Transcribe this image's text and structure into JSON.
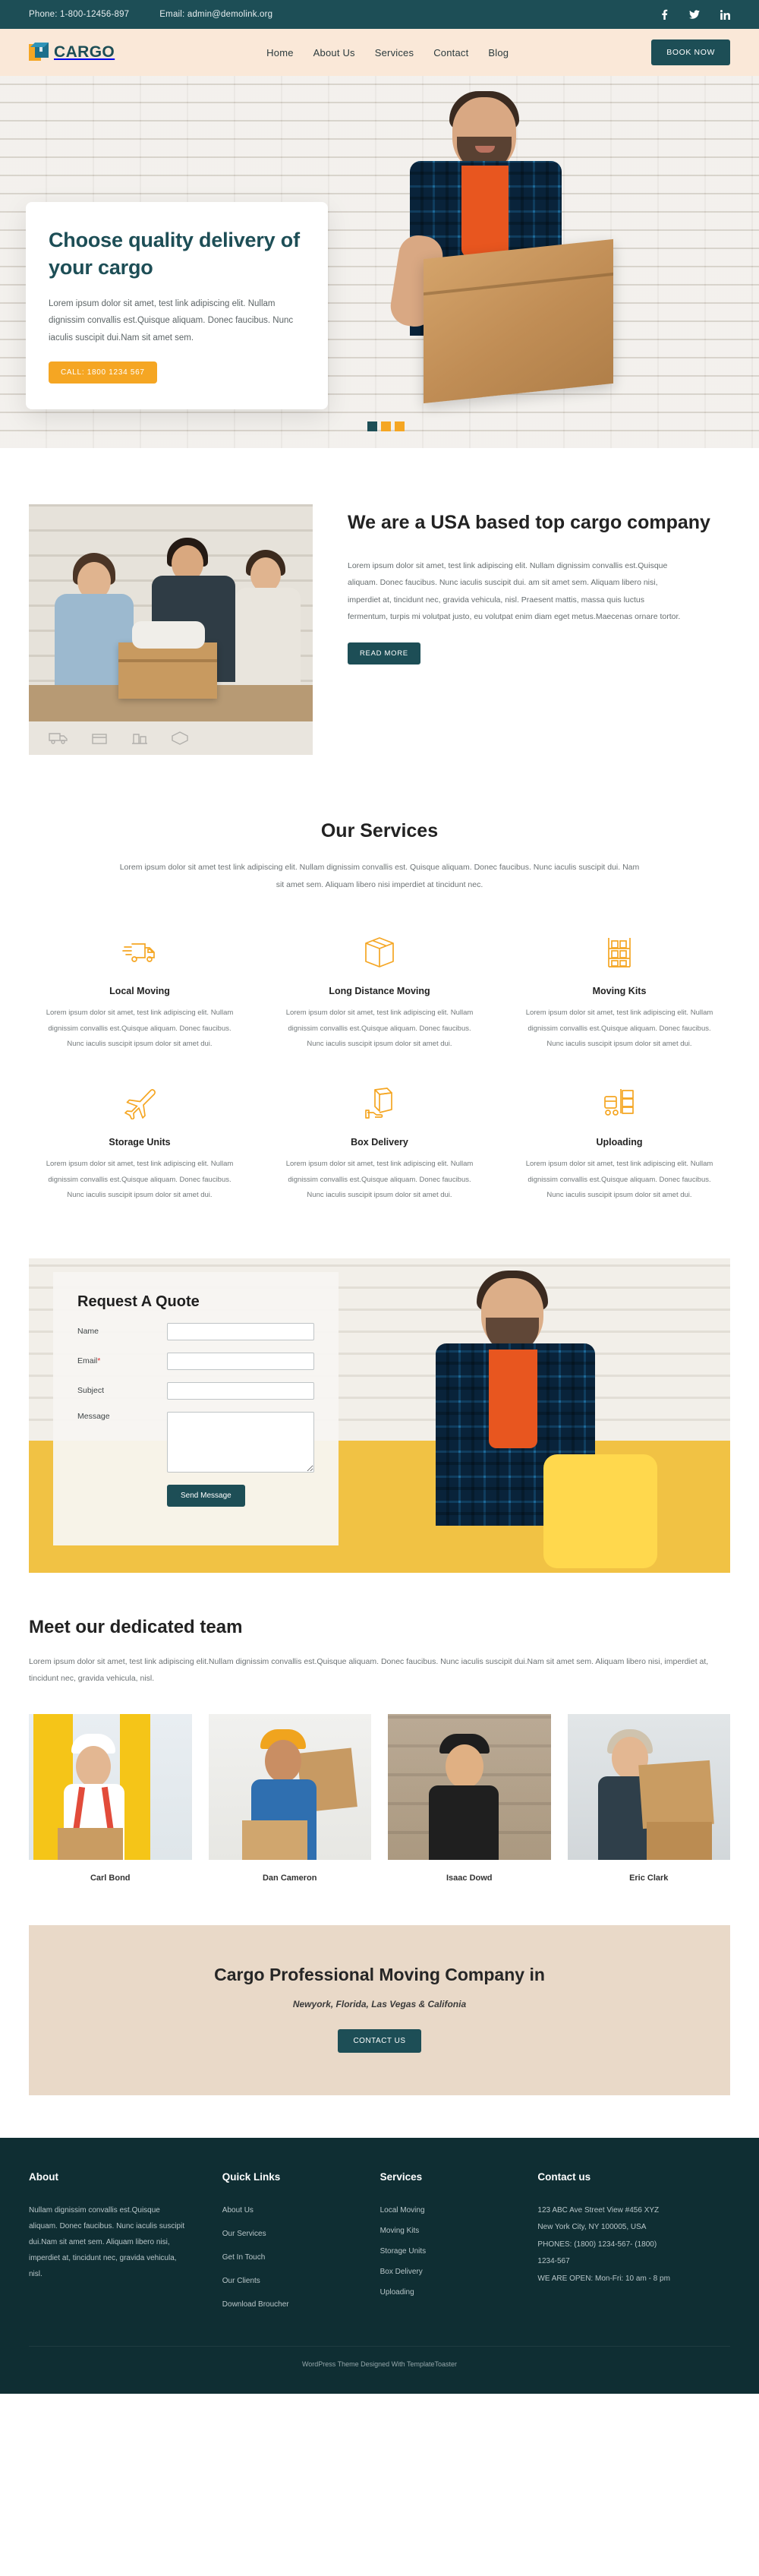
{
  "topbar": {
    "phone": "Phone: 1-800-12456-897",
    "email": "Email: admin@demolink.org",
    "social": [
      {
        "name": "facebook-icon",
        "label": "f"
      },
      {
        "name": "twitter-icon",
        "label": "t"
      },
      {
        "name": "linkedin-icon",
        "label": "in"
      }
    ]
  },
  "nav": {
    "brand": "CARGO",
    "links": [
      "Home",
      "About Us",
      "Services",
      "Contact",
      "Blog"
    ],
    "cta": "BOOK NOW"
  },
  "hero": {
    "title": "Choose quality delivery of your cargo",
    "body": "Lorem ipsum dolor sit amet, test link adipiscing elit. Nullam dignissim convallis est.Quisque aliquam. Donec faucibus. Nunc iaculis suscipit dui.Nam sit amet sem.",
    "button": "CALL: 1800 1234 567",
    "slides": 3,
    "active_slide": 1
  },
  "about": {
    "title": "We are a USA based top cargo company",
    "body": "Lorem ipsum dolor sit amet, test link adipiscing elit. Nullam dignissim convallis est.Quisque aliquam. Donec faucibus. Nunc iaculis suscipit dui. am sit amet sem. Aliquam libero nisi, imperdiet at, tincidunt nec, gravida vehicula, nisl. Praesent mattis, massa quis luctus fermentum, turpis mi volutpat justo, eu volutpat enim diam eget metus.Maecenas ornare tortor.",
    "button": "READ MORE"
  },
  "services": {
    "title": "Our Services",
    "subtitle": "Lorem ipsum dolor sit amet test link adipiscing elit. Nullam dignissim convallis est. Quisque aliquam. Donec faucibus. Nunc iaculis suscipit dui. Nam sit amet sem. Aliquam libero nisi imperdiet at tincidunt nec.",
    "body_text": "Lorem ipsum dolor sit amet, test link adipiscing elit. Nullam dignissim convallis est.Quisque aliquam. Donec faucibus. Nunc iaculis suscipit ipsum dolor sit amet dui.",
    "items": [
      {
        "title": "Local Moving",
        "icon": "delivery-truck-icon"
      },
      {
        "title": "Long Distance Moving",
        "icon": "cardboard-box-icon"
      },
      {
        "title": "Moving Kits",
        "icon": "warehouse-shelf-icon"
      },
      {
        "title": "Storage Units",
        "icon": "airplane-icon"
      },
      {
        "title": "Box Delivery",
        "icon": "box-in-hand-icon"
      },
      {
        "title": "Uploading",
        "icon": "hand-truck-icon"
      }
    ]
  },
  "quote": {
    "title": "Request A Quote",
    "fields": [
      {
        "label": "Name",
        "required": false,
        "value": "",
        "placeholder": ""
      },
      {
        "label": "Email",
        "required": true,
        "value": "",
        "placeholder": ""
      },
      {
        "label": "Subject",
        "required": false,
        "value": "",
        "placeholder": ""
      },
      {
        "label": "Message",
        "required": false,
        "value": "",
        "placeholder": ""
      }
    ],
    "submit": "Send Message"
  },
  "team": {
    "title": "Meet our dedicated team",
    "body": "Lorem ipsum dolor sit amet, test link adipiscing elit.Nullam dignissim convallis est.Quisque aliquam. Donec faucibus. Nunc iaculis suscipit dui.Nam sit amet sem. Aliquam libero nisi, imperdiet at, tincidunt nec, gravida vehicula, nisl.",
    "members": [
      {
        "name": "Carl Bond"
      },
      {
        "name": "Dan Cameron"
      },
      {
        "name": "Isaac Dowd"
      },
      {
        "name": "Eric Clark"
      }
    ]
  },
  "cta": {
    "title": "Cargo Professional Moving Company in",
    "subtitle": "Newyork, Florida, Las Vegas & Califonia",
    "button": "CONTACT US"
  },
  "footer": {
    "about": {
      "title": "About",
      "body": "Nullam dignissim convallis est.Quisque aliquam. Donec faucibus. Nunc iaculis suscipit dui.Nam sit amet sem. Aliquam libero nisi, imperdiet at, tincidunt nec, gravida vehicula, nisl."
    },
    "quick_links": {
      "title": "Quick Links",
      "items": [
        "About Us",
        "Our Services",
        "Get In Touch",
        "Our Clients",
        "Download Broucher"
      ]
    },
    "services": {
      "title": "Services",
      "items": [
        "Local Moving",
        "Moving Kits",
        "Storage Units",
        "Box Delivery",
        "Uploading"
      ]
    },
    "contact": {
      "title": "Contact us",
      "lines": [
        "123 ABC Ave Street View #456 XYZ",
        "New York City, NY 100005, USA",
        "PHONES: (1800) 1234-567- (1800)",
        "1234-567",
        "WE ARE OPEN: Mon-Fri: 10 am - 8 pm"
      ]
    },
    "bottom": "WordPress Theme Designed With TemplateToaster"
  },
  "colors": {
    "teal": "#1d4e56",
    "teal_dark": "#0f2e33",
    "orange": "#f5a623",
    "cream": "#fae8d8",
    "beige": "#e9d9c8"
  }
}
